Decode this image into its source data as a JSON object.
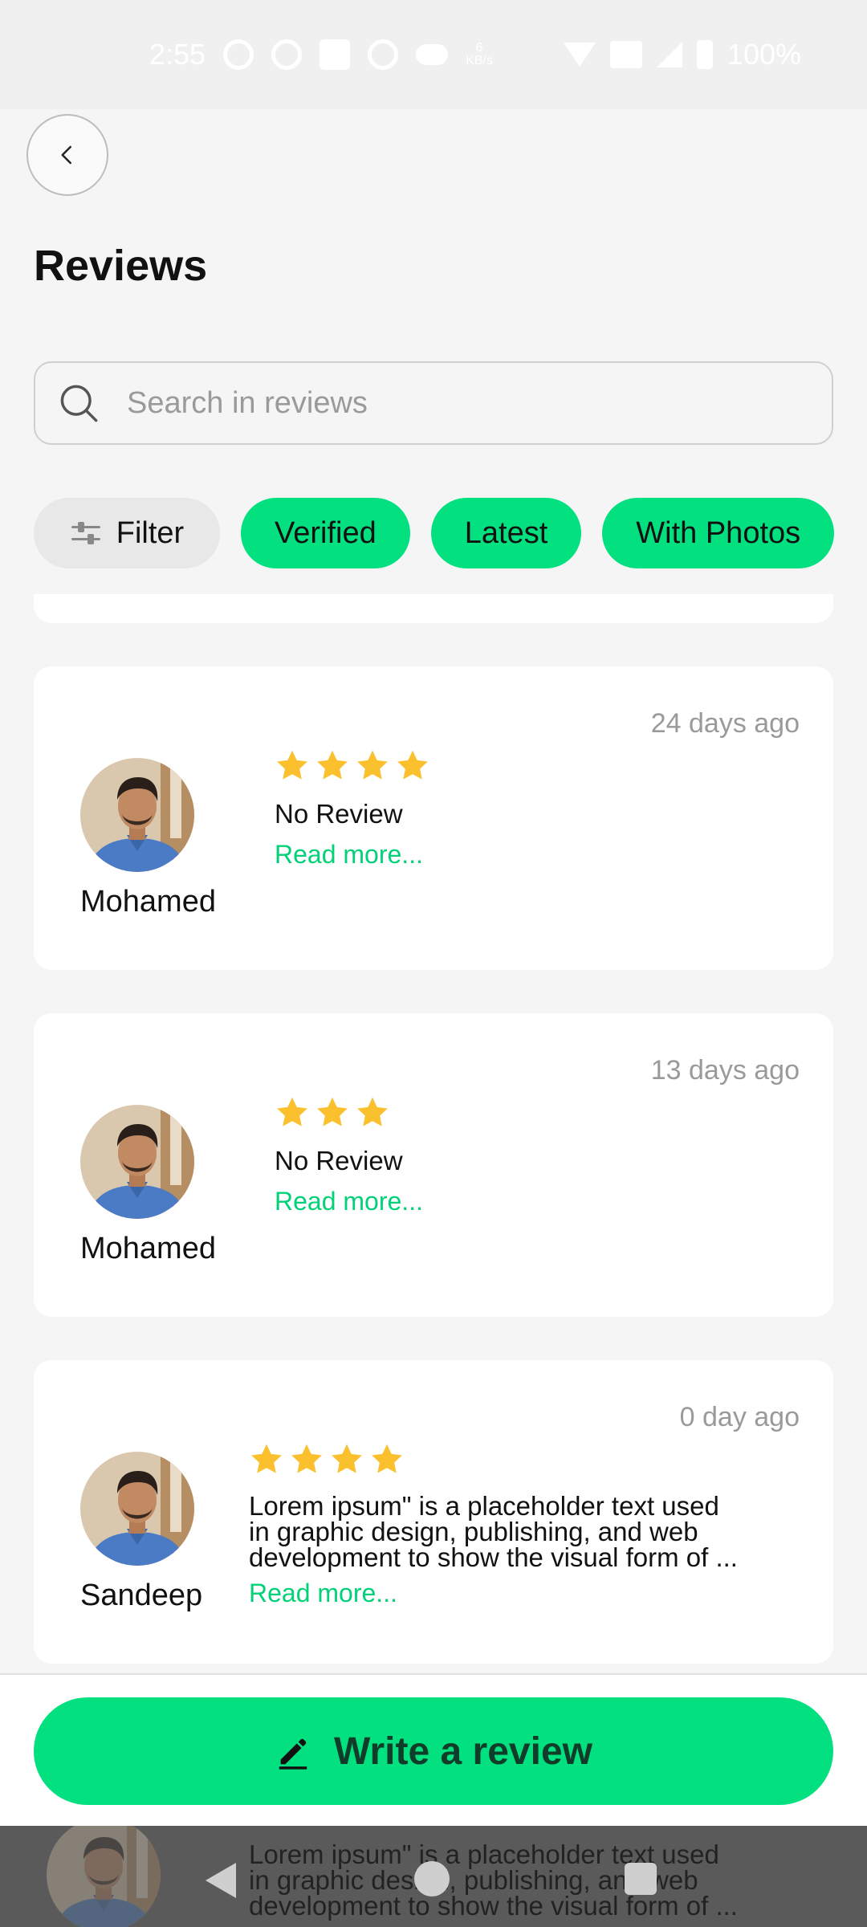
{
  "status_bar": {
    "time": "2:55",
    "net_speed_value": "6",
    "net_speed_unit": "KB/s",
    "battery": "100%"
  },
  "header": {
    "title": "Reviews"
  },
  "search": {
    "placeholder": "Search in reviews",
    "value": ""
  },
  "filters": {
    "filter_label": "Filter",
    "chips": [
      "Verified",
      "Latest",
      "With Photos"
    ]
  },
  "reviews": [
    {
      "name": "Mohamed",
      "time": "24 days ago",
      "rating": 4,
      "text": "No Review",
      "more": "Read more..."
    },
    {
      "name": "Mohamed",
      "time": "13 days ago",
      "rating": 3,
      "text": "No Review",
      "more": "Read more..."
    },
    {
      "name": "Sandeep",
      "time": "0 day ago",
      "rating": 4,
      "text_lines": [
        "Lorem ipsum\" is a placeholder text used",
        "in graphic design, publishing, and web",
        "development to show the visual form of ..."
      ],
      "more": "Read more..."
    }
  ],
  "footer": {
    "write_review_label": "Write a review"
  },
  "behind_nav_text": [
    "Lorem ipsum\" is a placeholder text used",
    "in graphic design, publishing, and web",
    "development to show the visual form of ..."
  ],
  "colors": {
    "accent": "#03e07f",
    "accent_text": "#03d178",
    "star": "#fbc02d",
    "time_text": "#9a9a9a"
  }
}
